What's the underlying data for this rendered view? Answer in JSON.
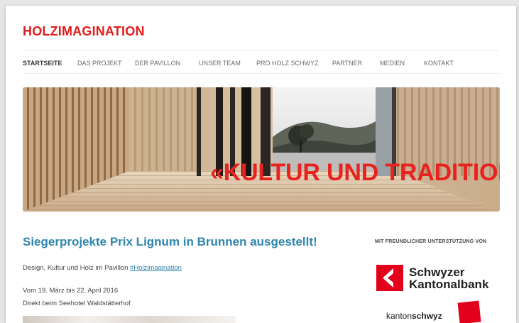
{
  "site": {
    "title": "HOLZIMAGINATION"
  },
  "nav": {
    "items": [
      {
        "label": "STARTSEITE",
        "active": true
      },
      {
        "label": "DAS PROJEKT",
        "active": false
      },
      {
        "label": "DER PAVILLON",
        "active": false
      },
      {
        "label": "UNSER TEAM",
        "active": false
      },
      {
        "label": "PRO HOLZ SCHWYZ",
        "active": false
      },
      {
        "label": "PARTNER",
        "active": false
      },
      {
        "label": "MEDIEN",
        "active": false
      },
      {
        "label": "KONTAKT",
        "active": false
      }
    ]
  },
  "hero": {
    "caption": "«KULTUR UND TRADITION»"
  },
  "article": {
    "headline": "Siegerprojekte Prix Lignum in Brunnen ausgestellt!",
    "intro": "Design, Kultur und Holz im Pavillon ",
    "hashtag": "#Holzimagination",
    "dates": "Vom 19. März bis 22. April 2016",
    "location": "Direkt beim Seehotel Waldstätterhof"
  },
  "sidebar": {
    "heading": "MIT FREUNDLICHER UNTERSTÜTZUNG VON",
    "sponsor1": {
      "line1": "Schwyzer",
      "line2": "Kantonalbank"
    },
    "sponsor2": {
      "prefix": "kanton",
      "bold": "schwyz"
    }
  },
  "colors": {
    "brand_red": "#e21b1b",
    "link_blue": "#2f85ad"
  }
}
